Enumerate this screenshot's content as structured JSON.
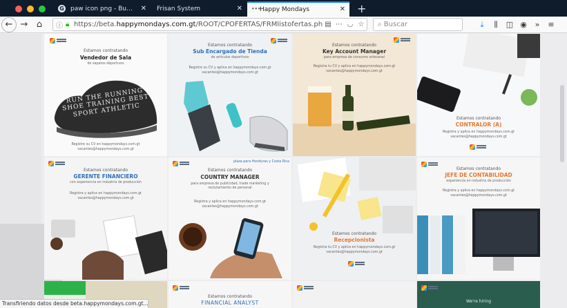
{
  "tabs": [
    {
      "label": "paw icon png - Buscar con Go",
      "favicon": "G"
    },
    {
      "label": "Frisan System",
      "favicon": ""
    },
    {
      "label": "Happy Mondays",
      "favicon": "•••"
    }
  ],
  "nav": {
    "url_prefix": "https://beta.",
    "url_domain": "happymondays.com.gt",
    "url_path": "/ROOT/CPOFERTAS/FRMlistofertas.php",
    "search_placeholder": "Buscar"
  },
  "tiles": [
    {
      "line1": "Estamos contratando",
      "title": "Vendedor de Sala",
      "line3": "de zapatos deportivos",
      "footer1": "Registre su CV en happymondays.com.gt",
      "footer2": "vacantes@happymondays.com.gt",
      "shoe_text": "RUN THE RUNNING SHOE TRAINING BEST SPORT ATHLETIC"
    },
    {
      "line1": "Estamos contratando",
      "title": "Sub Encargado de Tienda",
      "line3": "de artículos deportivos",
      "footer1": "Registre su CV y aplica en happymondays.com.gt",
      "footer2": "vacantes@happymondays.com.gt"
    },
    {
      "line1": "Estamos contratando",
      "title": "Key Account Manager",
      "line3": "para empresa de consumo artesanal",
      "footer1": "Registra tu CV y aplica en happymondays.com.gt",
      "footer2": "vacantes@happymondays.com.gt"
    },
    {
      "line1": "Estamos contratando",
      "title": "CONTRALOR (A)",
      "footer1": "Registra y aplica en happymondays.com.gt",
      "footer2": "vacantes@happymondays.com.gt"
    },
    {
      "line1": "Estamos contratando",
      "title": "GERENTE FINANCIERO",
      "line3": "con experiencia en industria de producción",
      "footer1": "Registra y aplica en happymondays.com.gt",
      "footer2": "vacantes@happymondays.com.gt"
    },
    {
      "line1": "Estamos contratando",
      "title": "COUNTRY MANAGER",
      "line3": "para empresa de publicidad, trade marketing y reclutamiento de personal",
      "footer1": "Registra y aplica en happymondays.com.gt",
      "footer2": "vacantes@happymondays.com.gt",
      "corner": "plaza para Honduras y Costa Rica"
    },
    {
      "line1": "Estamos contratando",
      "title": "Recepcionista",
      "footer1": "Registra tu CV y aplica en happymondays.com.gt",
      "footer2": "vacantes@happymondays.com.gt"
    },
    {
      "line1": "Estamos contratando",
      "title": "JEFE DE CONTABILIDAD",
      "line3": "experiencia en industria de producción",
      "footer1": "Registra y aplica en happymondays.com.gt",
      "footer2": "vacantes@happymondays.com.gt"
    },
    {
      "title": ""
    },
    {
      "line1": "Estamos contratando",
      "title": "FINANCIAL ANALYST"
    },
    {
      "title": ""
    },
    {
      "line1": "We're hiring"
    }
  ],
  "status_text": "Transfiriendo datos desde beta.happymondays.com.gt...",
  "colors": {
    "accent": "#0a84ff",
    "tab_strip": "#0f1c2b",
    "title_blue": "#2e6fb8",
    "title_orange": "#e8762c"
  }
}
